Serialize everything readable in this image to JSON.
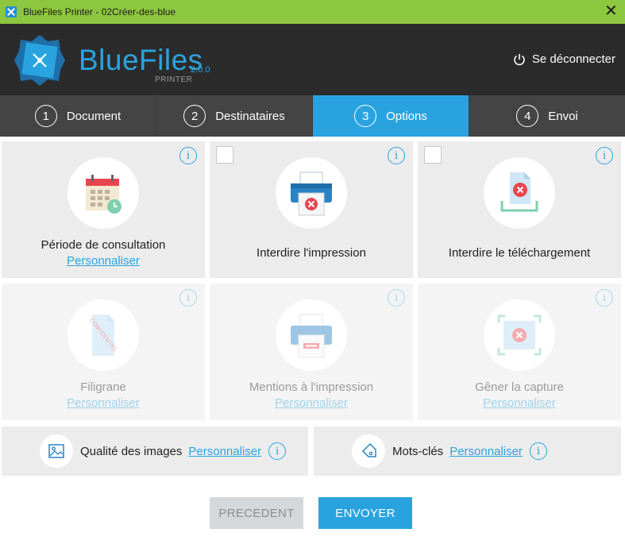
{
  "window": {
    "title": "BlueFiles Printer - 02Créer-des-blue",
    "close_glyph": "✕"
  },
  "header": {
    "brand": "BlueFiles",
    "version": "2.0.0",
    "product": "PRINTER",
    "logout_label": "Se déconnecter"
  },
  "steps": [
    {
      "num": "1",
      "label": "Document",
      "active": false
    },
    {
      "num": "2",
      "label": "Destinataires",
      "active": false
    },
    {
      "num": "3",
      "label": "Options",
      "active": true
    },
    {
      "num": "4",
      "label": "Envoi",
      "active": false
    }
  ],
  "options": {
    "info_glyph": "i",
    "period": {
      "label": "Période de consultation",
      "link": "Personnaliser",
      "icon": "calendar-icon"
    },
    "no_print": {
      "label": "Interdire l'impression",
      "icon": "printer-blocked-icon",
      "checked": false
    },
    "no_download": {
      "label": "Interdire le téléchargement",
      "icon": "download-blocked-icon",
      "checked": false
    },
    "watermark": {
      "label": "Filigrane",
      "link": "Personnaliser",
      "icon": "watermark-document-icon",
      "stamp": "CONFIDENTIEL",
      "enabled": false
    },
    "print_mentions": {
      "label": "Mentions à l'impression",
      "link": "Personnaliser",
      "icon": "printer-mentions-icon",
      "enabled": false
    },
    "screen_capture": {
      "label": "Gêner la capture",
      "link": "Personnaliser",
      "icon": "screen-capture-icon",
      "enabled": false
    },
    "image_quality": {
      "label": "Qualité des images",
      "link": "Personnaliser",
      "icon": "image-icon"
    },
    "keywords": {
      "label": "Mots-clés",
      "link": "Personnaliser",
      "icon": "tag-icon"
    }
  },
  "buttons": {
    "previous": "PRECEDENT",
    "send": "ENVOYER"
  },
  "colors": {
    "accent": "#29a3e0",
    "titlebar": "#8dc63f",
    "header": "#2b2b2b",
    "danger": "#e8464f"
  }
}
